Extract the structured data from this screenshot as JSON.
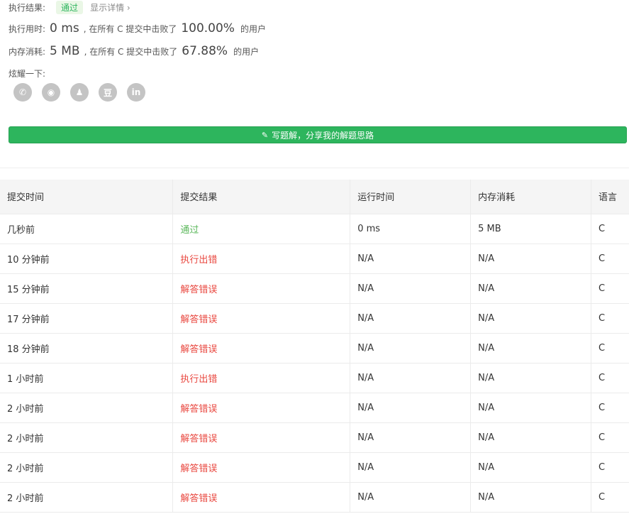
{
  "result": {
    "label": "执行结果:",
    "badge": "通过",
    "detail_link": "显示详情 ›"
  },
  "runtime": {
    "label": "执行用时:",
    "value": "0 ms",
    "text": ", 在所有 C 提交中击败了",
    "percent": "100.00%",
    "suffix": "的用户"
  },
  "memory": {
    "label": "内存消耗:",
    "value": "5 MB",
    "text": ", 在所有 C 提交中击败了",
    "percent": "67.88%",
    "suffix": "的用户"
  },
  "share": {
    "label": "炫耀一下:",
    "icons": [
      {
        "name": "wechat-icon",
        "glyph": "✆"
      },
      {
        "name": "weibo-icon",
        "glyph": "◉"
      },
      {
        "name": "qq-icon",
        "glyph": "♟"
      },
      {
        "name": "douban-icon",
        "glyph": "豆"
      },
      {
        "name": "linkedin-icon",
        "glyph": "in"
      }
    ]
  },
  "write_button": {
    "label": "写题解，分享我的解题思路"
  },
  "table": {
    "headers": [
      "提交时间",
      "提交结果",
      "运行时间",
      "内存消耗",
      "语言"
    ],
    "rows": [
      {
        "time": "几秒前",
        "result": "通过",
        "status": "ok",
        "runtime": "0 ms",
        "memory": "5 MB",
        "lang": "C"
      },
      {
        "time": "10 分钟前",
        "result": "执行出错",
        "status": "err",
        "runtime": "N/A",
        "memory": "N/A",
        "lang": "C"
      },
      {
        "time": "15 分钟前",
        "result": "解答错误",
        "status": "err",
        "runtime": "N/A",
        "memory": "N/A",
        "lang": "C"
      },
      {
        "time": "17 分钟前",
        "result": "解答错误",
        "status": "err",
        "runtime": "N/A",
        "memory": "N/A",
        "lang": "C"
      },
      {
        "time": "18 分钟前",
        "result": "解答错误",
        "status": "err",
        "runtime": "N/A",
        "memory": "N/A",
        "lang": "C"
      },
      {
        "time": "1 小时前",
        "result": "执行出错",
        "status": "err",
        "runtime": "N/A",
        "memory": "N/A",
        "lang": "C"
      },
      {
        "time": "2 小时前",
        "result": "解答错误",
        "status": "err",
        "runtime": "N/A",
        "memory": "N/A",
        "lang": "C"
      },
      {
        "time": "2 小时前",
        "result": "解答错误",
        "status": "err",
        "runtime": "N/A",
        "memory": "N/A",
        "lang": "C"
      },
      {
        "time": "2 小时前",
        "result": "解答错误",
        "status": "err",
        "runtime": "N/A",
        "memory": "N/A",
        "lang": "C"
      },
      {
        "time": "2 小时前",
        "result": "解答错误",
        "status": "err",
        "runtime": "N/A",
        "memory": "N/A",
        "lang": "C"
      }
    ]
  },
  "colors": {
    "accent_green": "#2db55d",
    "pass_green": "#5cb85c",
    "error_red": "#e9473f",
    "icon_grey": "#c4c4c4"
  }
}
